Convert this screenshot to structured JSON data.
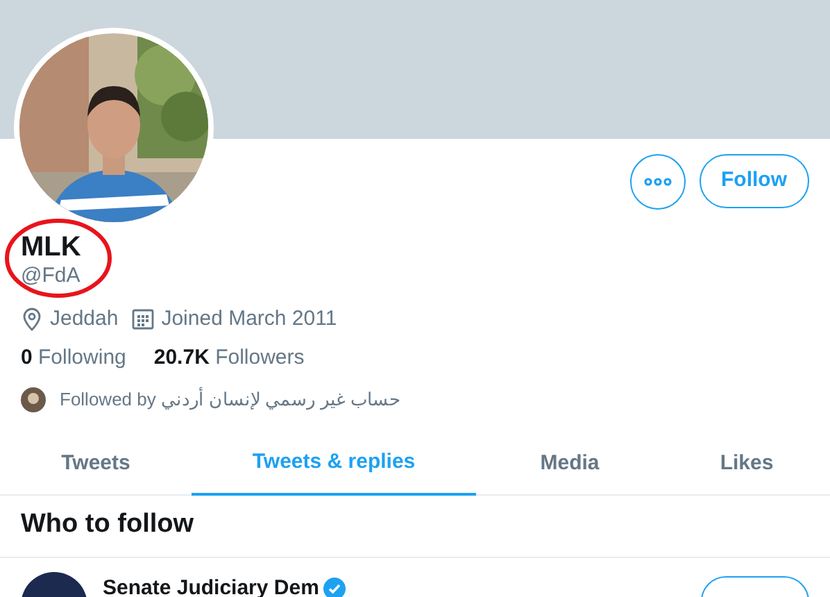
{
  "profile": {
    "name": "MLK",
    "handle": "@FdA",
    "location": "Jeddah",
    "joined": "Joined March 2011",
    "following_count": "0",
    "following_label": "Following",
    "followers_count": "20.7K",
    "followers_label": "Followers",
    "followed_by": "Followed by حساب غير رسمي لإنسان أردني"
  },
  "actions": {
    "follow_button": "Follow"
  },
  "tabs": [
    {
      "label": "Tweets",
      "selected": false
    },
    {
      "label": "Tweets & replies",
      "selected": true
    },
    {
      "label": "Media",
      "selected": false
    },
    {
      "label": "Likes",
      "selected": false
    }
  ],
  "who_to_follow": {
    "title": "Who to follow",
    "accounts": [
      {
        "name": "Senate Judiciary Dem",
        "verified": true
      }
    ]
  }
}
